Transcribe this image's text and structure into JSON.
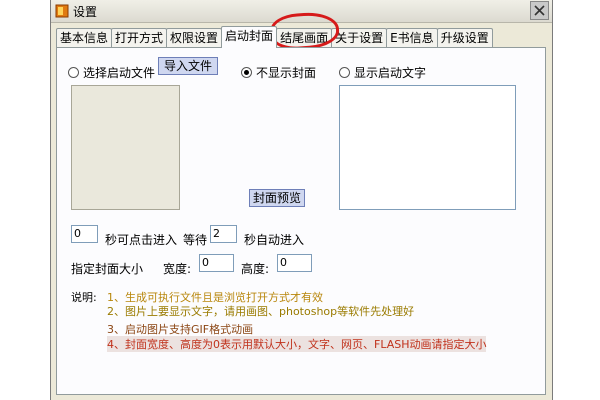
{
  "window": {
    "title": "设置"
  },
  "tabs": [
    {
      "label": "基本信息"
    },
    {
      "label": "打开方式"
    },
    {
      "label": "权限设置"
    },
    {
      "label": "启动封面",
      "active": true
    },
    {
      "label": "结尾画面"
    },
    {
      "label": "关于设置"
    },
    {
      "label": "E书信息"
    },
    {
      "label": "升级设置"
    }
  ],
  "cover": {
    "radio_select_file": "选择启动文件",
    "import_button": "导入文件",
    "radio_no_cover": "不显示封面",
    "radio_show_text": "显示启动文字",
    "selected": "不显示封面",
    "preview_button": "封面预览"
  },
  "timing": {
    "click_seconds_value": "0",
    "click_seconds_label": "秒可点击进入",
    "wait_label": "等待",
    "wait_value": "2",
    "auto_seconds_label": "秒自动进入"
  },
  "size": {
    "label": "指定封面大小",
    "width_label": "宽度:",
    "width_value": "0",
    "height_label": "高度:",
    "height_value": "0"
  },
  "notes": {
    "prefix": "说明:",
    "items": [
      "1、生成可执行文件且是浏览打开方式才有效",
      "2、图片上要显示文字，请用画图、photoshop等软件先处理好",
      "3、启动图片支持GIF格式动画",
      "4、封面宽度、高度为0表示用默认大小，文字、网页、FLASH动画请指定大小"
    ]
  },
  "colors": {
    "note_1": "#b8860b",
    "note_2": "#9a7b00",
    "note_3": "#8b4513",
    "note_4": "#c0311b",
    "highlight_ring": "#d61a1a"
  }
}
